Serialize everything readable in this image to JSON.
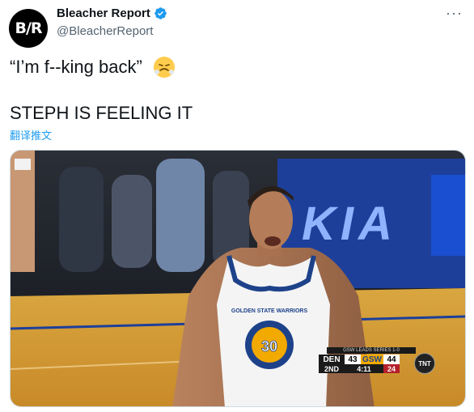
{
  "account": {
    "avatar_text": "B/R",
    "display_name": "Bleacher Report",
    "handle": "@BleacherReport",
    "more_glyph": "···"
  },
  "tweet": {
    "line1": "“I’m f--king back”",
    "line2": "STEPH IS FEELING IT",
    "translate_link": "翻译推文"
  },
  "scoreboard": {
    "series_text": "GSW LEADS SERIES 1-0",
    "team1": "DEN",
    "score1": "43",
    "team2": "GSW",
    "score2": "44",
    "quarter": "2ND",
    "clock": "4:11",
    "shot_clock": "24",
    "network": "TNT"
  },
  "jersey": {
    "text": "GOLDEN STATE WARRIORS",
    "number": "30"
  },
  "arena_sign": "KIA",
  "colors": {
    "verified_blue": "#1d9bf0",
    "link_blue": "#1d9bf0",
    "gsw_gold": "#f2a900",
    "den_dark": "#1a1a1a",
    "shot_red": "#b3202a"
  }
}
